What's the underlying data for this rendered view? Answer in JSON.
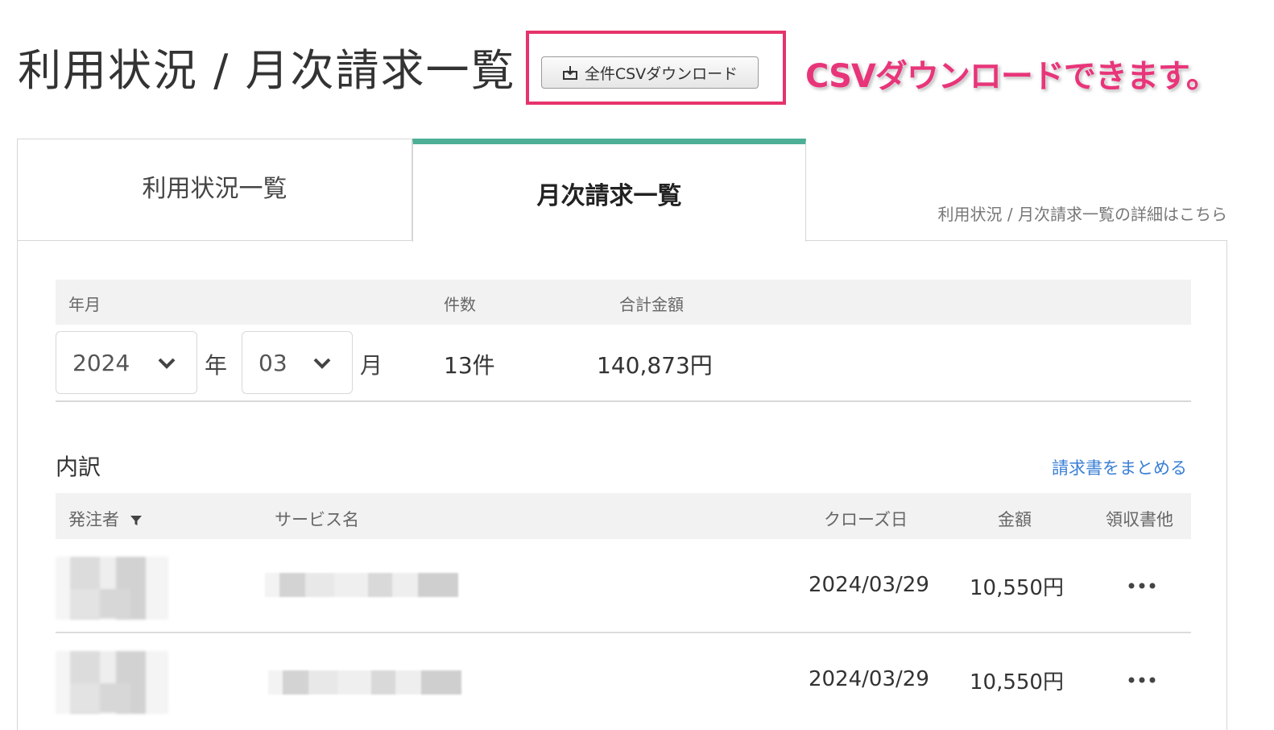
{
  "header": {
    "title": "利用状況 / 月次請求一覧",
    "csv_button_label": "全件CSVダウンロード",
    "callout": "CSVダウンロードできます。"
  },
  "tabs": [
    {
      "label": "利用状況一覧",
      "active": false
    },
    {
      "label": "月次請求一覧",
      "active": true
    }
  ],
  "details_link": "利用状況 / 月次請求一覧の詳細はこちら",
  "summary": {
    "col_yearmonth": "年月",
    "col_count": "件数",
    "col_total": "合計金額",
    "year": "2024",
    "year_unit": "年",
    "month": "03",
    "month_unit": "月",
    "count": "13件",
    "total": "140,873円"
  },
  "breakdown": {
    "title": "内訳",
    "merge_link": "請求書をまとめる",
    "columns": {
      "orderer": "発注者",
      "service": "サービス名",
      "close_date": "クローズ日",
      "amount": "金額",
      "receipt": "領収書他"
    },
    "rows": [
      {
        "close_date": "2024/03/29",
        "amount": "10,550円"
      },
      {
        "close_date": "2024/03/29",
        "amount": "10,550円"
      }
    ]
  },
  "colors": {
    "accent_tab": "#4caf96",
    "highlight": "#e6336c",
    "link": "#3a7fd5"
  },
  "icons": {
    "download": "download-icon",
    "chevron": "chevron-down-icon",
    "filter": "filter-icon",
    "more": "more-horizontal-icon"
  }
}
